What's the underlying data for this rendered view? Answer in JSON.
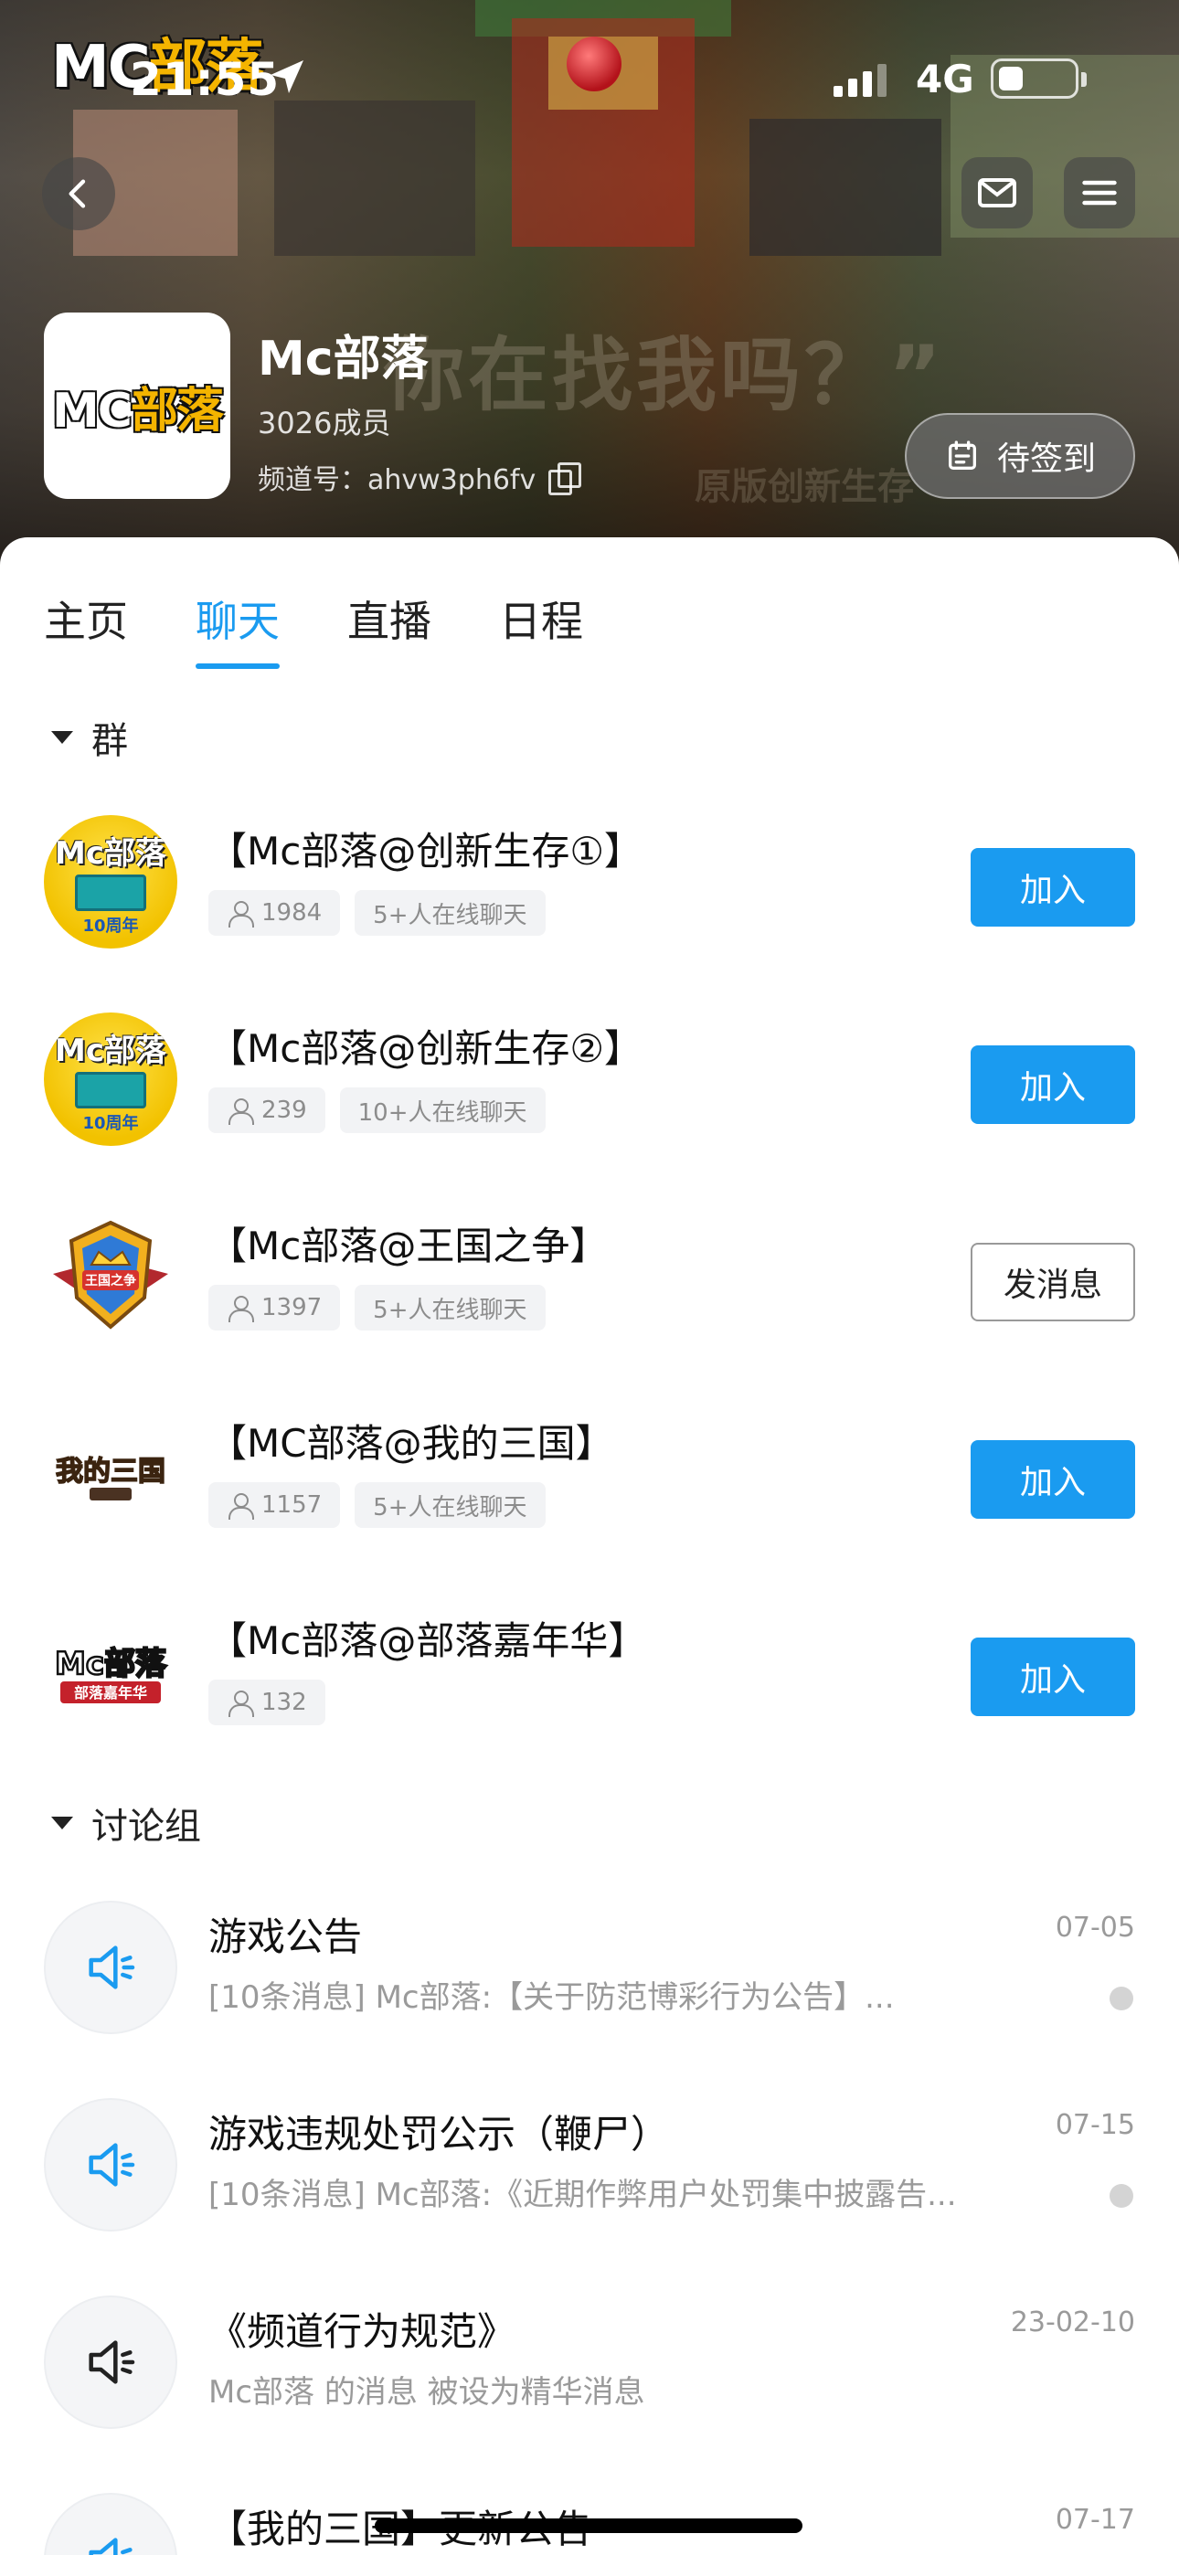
{
  "status_bar": {
    "time": "21:55",
    "network": "4G"
  },
  "banner": {
    "brand_prefix": "MC",
    "brand_suffix": "部落",
    "slogan": "你在找我吗？”",
    "sub": "原版创新生存"
  },
  "channel": {
    "avatar_prefix": "MC",
    "avatar_suffix": "部落",
    "name": "Mc部落",
    "members": "3026成员",
    "id_label": "频道号：ahvw3ph6fv",
    "signin_label": "待签到"
  },
  "tabs": [
    "主页",
    "聊天",
    "直播",
    "日程"
  ],
  "active_tab": "聊天",
  "groups": {
    "header": "群",
    "items": [
      {
        "title": "【Mc部落@创新生存①】",
        "count": "1984",
        "online": "5+人在线聊天",
        "action": "加入",
        "avatar_top": "Mc部落",
        "avatar_year": "10周年"
      },
      {
        "title": "【Mc部落@创新生存②】",
        "count": "239",
        "online": "10+人在线聊天",
        "action": "加入",
        "avatar_top": "Mc部落",
        "avatar_year": "10周年"
      },
      {
        "title": "【Mc部落@王国之争】",
        "count": "1397",
        "online": "5+人在线聊天",
        "action": "发消息",
        "avatar_text": "王国之争"
      },
      {
        "title": "【MC部落@我的三国】",
        "count": "1157",
        "online": "5+人在线聊天",
        "action": "加入",
        "avatar_text": "我的三国"
      },
      {
        "title": "【Mc部落@部落嘉年华】",
        "count": "132",
        "online": "",
        "action": "加入",
        "avatar_text": "部落嘉年华"
      }
    ]
  },
  "discussions": {
    "header": "讨论组",
    "items": [
      {
        "title": "游戏公告",
        "subtitle": "[10条消息] Mc部落:【关于防范博彩行为公告】...",
        "date": "07-05",
        "unread_dot": true,
        "icon_color": "#1a9bf0"
      },
      {
        "title": "游戏违规处罚公示（鞭尸）",
        "subtitle": "[10条消息] Mc部落:《近期作弊用户处罚集中披露告...",
        "date": "07-15",
        "unread_dot": true,
        "icon_color": "#1a9bf0"
      },
      {
        "title": "《频道行为规范》",
        "subtitle": "Mc部落 的消息 被设为精华消息",
        "date": "23-02-10",
        "unread_dot": false,
        "icon_color": "#222222"
      },
      {
        "title": "【我的三国】更新公告",
        "subtitle": "",
        "date": "07-17",
        "unread_dot": false,
        "icon_color": "#1a9bf0"
      }
    ]
  },
  "colors": {
    "accent": "#1a9bf0",
    "tag_bg": "#f2f3f5",
    "muted": "#9a9a9a"
  }
}
